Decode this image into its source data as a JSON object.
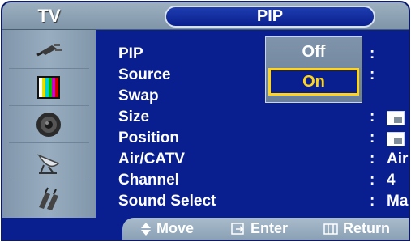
{
  "header": {
    "section": "TV",
    "title": "PIP"
  },
  "sidebar": {
    "icons": [
      "plug-icon",
      "color-bars-icon",
      "speaker-icon",
      "satellite-dish-icon",
      "connector-icon"
    ]
  },
  "menu": {
    "items": [
      {
        "label": "PIP",
        "value": ""
      },
      {
        "label": "Source",
        "value": ""
      },
      {
        "label": "Swap",
        "value": ""
      },
      {
        "label": "Size",
        "value": ""
      },
      {
        "label": "Position",
        "value": ""
      },
      {
        "label": "Air/CATV",
        "value": "Air"
      },
      {
        "label": "Channel",
        "value": "4"
      },
      {
        "label": "Sound Select",
        "value": "Main"
      }
    ],
    "separator": ":"
  },
  "dropdown": {
    "options": [
      "Off",
      "On"
    ],
    "selected": "On"
  },
  "footer": {
    "move": "Move",
    "enter": "Enter",
    "return": "Return"
  },
  "colors": {
    "background": "#0a1f8f",
    "highlight": "#ffd41a",
    "panel": "#8196aa"
  }
}
